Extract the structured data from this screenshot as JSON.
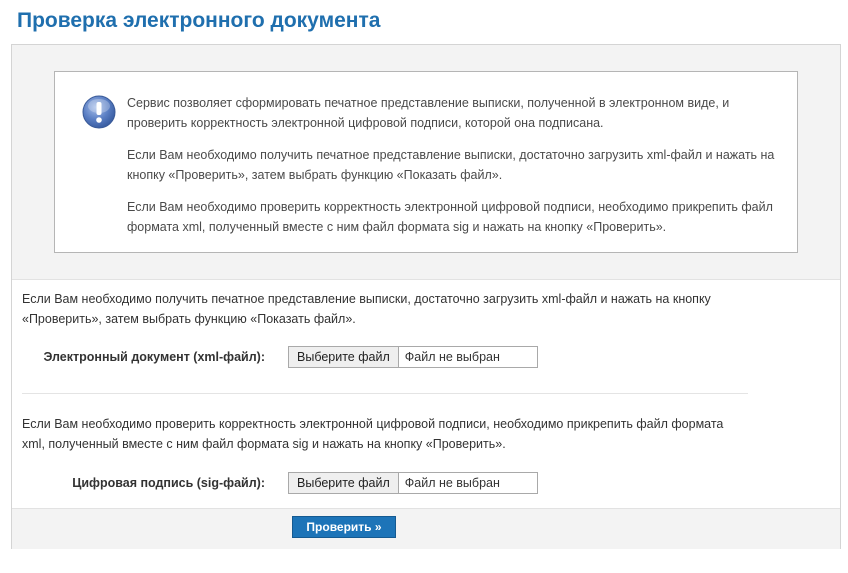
{
  "page": {
    "title": "Проверка электронного документа"
  },
  "info": {
    "icon": "exclamation-info-icon",
    "paragraphs": [
      "Сервис позволяет сформировать печатное представление выписки, полученной в электронном виде, и проверить корректность электронной цифровой подписи, которой она подписана.",
      "Если Вам необходимо получить печатное представление выписки, достаточно загрузить xml-файл и нажать на кнопку «Проверить», затем выбрать функцию «Показать файл».",
      "Если Вам необходимо проверить корректность электронной цифровой подписи, необходимо прикрепить файл формата xml, полученный вместе с ним файл формата sig и нажать на кнопку «Проверить»."
    ]
  },
  "xml_section": {
    "description": "Если Вам необходимо получить печатное представление выписки, достаточно загрузить xml-файл и нажать на кнопку «Проверить», затем выбрать функцию «Показать файл».",
    "label": "Электронный документ (xml-файл):",
    "button": "Выберите файл",
    "status": "Файл не выбран"
  },
  "sig_section": {
    "description": "Если Вам необходимо проверить корректность электронной цифровой подписи, необходимо прикрепить файл формата xml, полученный вместе с ним файл формата sig и нажать на кнопку «Проверить».",
    "label": "Цифровая подпись (sig-файл):",
    "button": "Выберите файл",
    "status": "Файл не выбран"
  },
  "submit": {
    "label": "Проверить »"
  },
  "colors": {
    "title": "#1f6fae",
    "button": "#1d74b8",
    "icon": "#5b7fc4"
  }
}
